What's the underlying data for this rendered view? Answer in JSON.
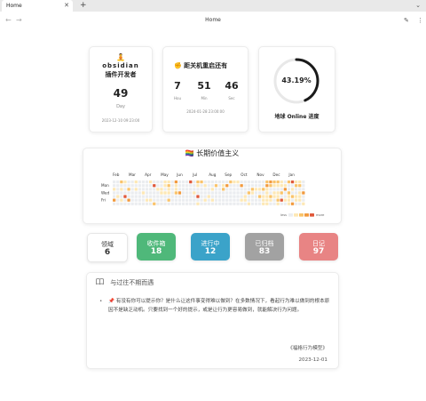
{
  "tabbar": {
    "tab_title": "Home",
    "close_glyph": "✕",
    "new_tab_glyph": "+",
    "menu_glyph": "⌄"
  },
  "navbar": {
    "back_glyph": "←",
    "forward_glyph": "→",
    "view_title": "Home",
    "edit_glyph": "✎",
    "more_glyph": "⋮"
  },
  "profile": {
    "icon": "🧘",
    "name": "obsidian",
    "role": "插件开发者",
    "days": "49",
    "days_unit": "Day",
    "since": "2023-12-10 09:23:00"
  },
  "countdown": {
    "icon": "✊",
    "title": "距关机重启还有",
    "hours": "7",
    "hours_unit": "Hou",
    "mins": "51",
    "mins_unit": "Min",
    "secs": "46",
    "secs_unit": "Sec",
    "target": "2024-01-28 23:00:00"
  },
  "progress": {
    "percent_text": "43.19%",
    "value": 0.4319,
    "label": "地球 Online 进度",
    "color": "#1a1a1a",
    "track_color": "#e8e8e8"
  },
  "heatmap": {
    "title": "🏳️‍🌈 长期价值主义",
    "months": [
      "Feb",
      "Mar",
      "Apr",
      "May",
      "Jun",
      "Jul",
      "Aug",
      "Sep",
      "Oct",
      "Nov",
      "Dec",
      "Jan"
    ],
    "weekdays": [
      "Mon",
      "Wed",
      "Fri"
    ],
    "legend_less": "less",
    "legend_more": "more",
    "colors": [
      "#ebedf0",
      "#fde8b5",
      "#f9c36a",
      "#f29a3e",
      "#e0593a"
    ],
    "weeks": 53
  },
  "stats": [
    {
      "label": "领域",
      "value": "6"
    },
    {
      "label": "收件箱",
      "value": "18"
    },
    {
      "label": "进行中",
      "value": "12"
    },
    {
      "label": "已归档",
      "value": "83"
    },
    {
      "label": "日记",
      "value": "97"
    }
  ],
  "quote": {
    "book_icon": "book-icon",
    "header": "与过往不期而遇",
    "bullet": "•",
    "text": "📌 有没有你可以提示你？是什么让这件事变得难以做到？在多数情况下，看起行为难以做到的根本原因不是缺乏动机。只要找到一个好的提示，或是让行为更容易做到，就能解决行为问题。",
    "source": "《福格行为模型》",
    "date": "2023-12-01"
  }
}
